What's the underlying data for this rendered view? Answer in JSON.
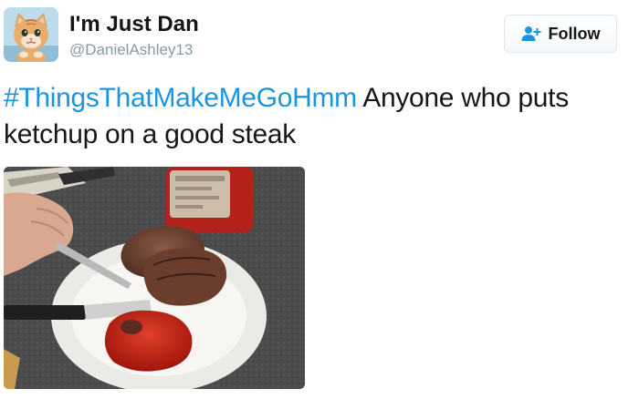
{
  "user": {
    "display_name": "I'm Just Dan",
    "screen_name": "@DanielAshley13",
    "avatar_icon": "kitten-avatar"
  },
  "follow": {
    "label": "Follow",
    "icon": "add-user-icon",
    "icon_color": "#1b95e0"
  },
  "tweet": {
    "hashtag": "#ThingsThatMakeMeGoHmm",
    "text": " Anyone who puts ketchup on a good steak",
    "hashtag_color": "#1b95e0"
  },
  "media": {
    "type": "photo"
  }
}
